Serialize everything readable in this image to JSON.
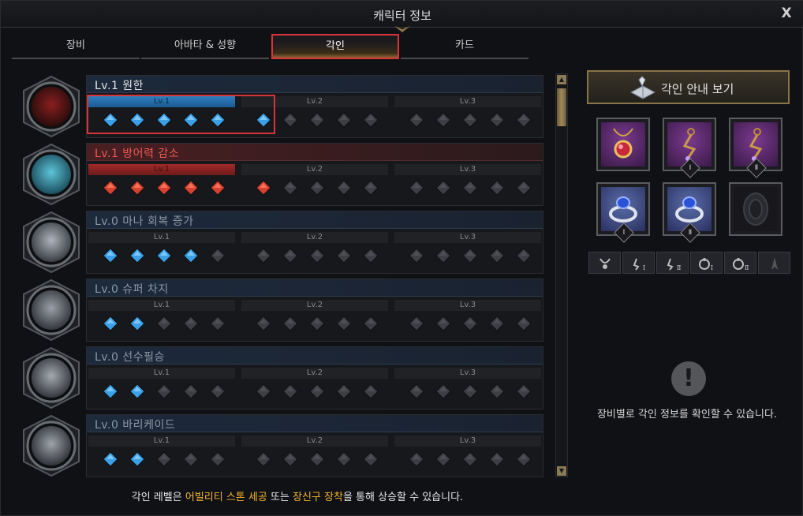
{
  "window": {
    "title": "캐릭터 정보",
    "close_label": "X"
  },
  "tabs": [
    {
      "label": "장비",
      "active": false
    },
    {
      "label": "아바타 & 성향",
      "active": false
    },
    {
      "label": "각인",
      "active": true
    },
    {
      "label": "카드",
      "active": false
    }
  ],
  "engravings": [
    {
      "name": "Lv.1 원한",
      "style": "normal",
      "bar": "blue",
      "filled_color": "blue",
      "filled": 6,
      "highlighted": true,
      "portrait": "wolf"
    },
    {
      "name": "Lv.1 방어력 감소",
      "style": "red",
      "bar": "red",
      "filled_color": "red",
      "filled": 6,
      "highlighted": false,
      "portrait": "shield"
    },
    {
      "name": "Lv.0 마나 회복 증가",
      "style": "dim",
      "bar": "none",
      "filled_color": "blue",
      "filled": 4,
      "highlighted": false,
      "portrait": "mana"
    },
    {
      "name": "Lv.0 슈퍼 차지",
      "style": "dim",
      "bar": "none",
      "filled_color": "blue",
      "filled": 2,
      "highlighted": false,
      "portrait": "charge"
    },
    {
      "name": "Lv.0 선수필승",
      "style": "dim",
      "bar": "none",
      "filled_color": "blue",
      "filled": 2,
      "highlighted": false,
      "portrait": "strike"
    },
    {
      "name": "Lv.0 바리케이드",
      "style": "dim",
      "bar": "none",
      "filled_color": "blue",
      "filled": 2,
      "highlighted": false,
      "portrait": "barricade"
    }
  ],
  "level_labels": [
    "Lv.1",
    "Lv.2",
    "Lv.3"
  ],
  "footer": {
    "part1": "각인 레벨은 ",
    "hl1": "어빌리티 스톤 세공",
    "part2": " 또는 ",
    "hl2": "장신구 장착",
    "part3": "을 통해 상승할 수 있습니다."
  },
  "guide_button": {
    "label": "각인 안내 보기"
  },
  "slots": [
    {
      "kind": "necklace",
      "color": "purple",
      "roman": ""
    },
    {
      "kind": "earring",
      "color": "purple",
      "roman": "Ⅰ"
    },
    {
      "kind": "earring",
      "color": "purple",
      "roman": "Ⅱ"
    },
    {
      "kind": "ring",
      "color": "blue",
      "roman": "Ⅰ"
    },
    {
      "kind": "ring",
      "color": "blue",
      "roman": "Ⅱ"
    },
    {
      "kind": "stone",
      "color": "empty",
      "roman": ""
    }
  ],
  "filters": [
    {
      "icon": "necklace-icon",
      "roman": ""
    },
    {
      "icon": "earring-icon",
      "roman": "Ⅰ"
    },
    {
      "icon": "earring-icon",
      "roman": "Ⅱ"
    },
    {
      "icon": "ring-icon",
      "roman": "Ⅰ"
    },
    {
      "icon": "ring-icon",
      "roman": "Ⅱ"
    },
    {
      "icon": "stone-icon",
      "roman": ""
    }
  ],
  "info": {
    "icon_glyph": "!",
    "message": "장비별로 각인 정보를 확인할 수 있습니다."
  },
  "colors": {
    "accent_red": "#d9333a",
    "gold": "#f3b62f",
    "blue_gem": "#3aa0e8",
    "red_gem": "#d8412f"
  }
}
